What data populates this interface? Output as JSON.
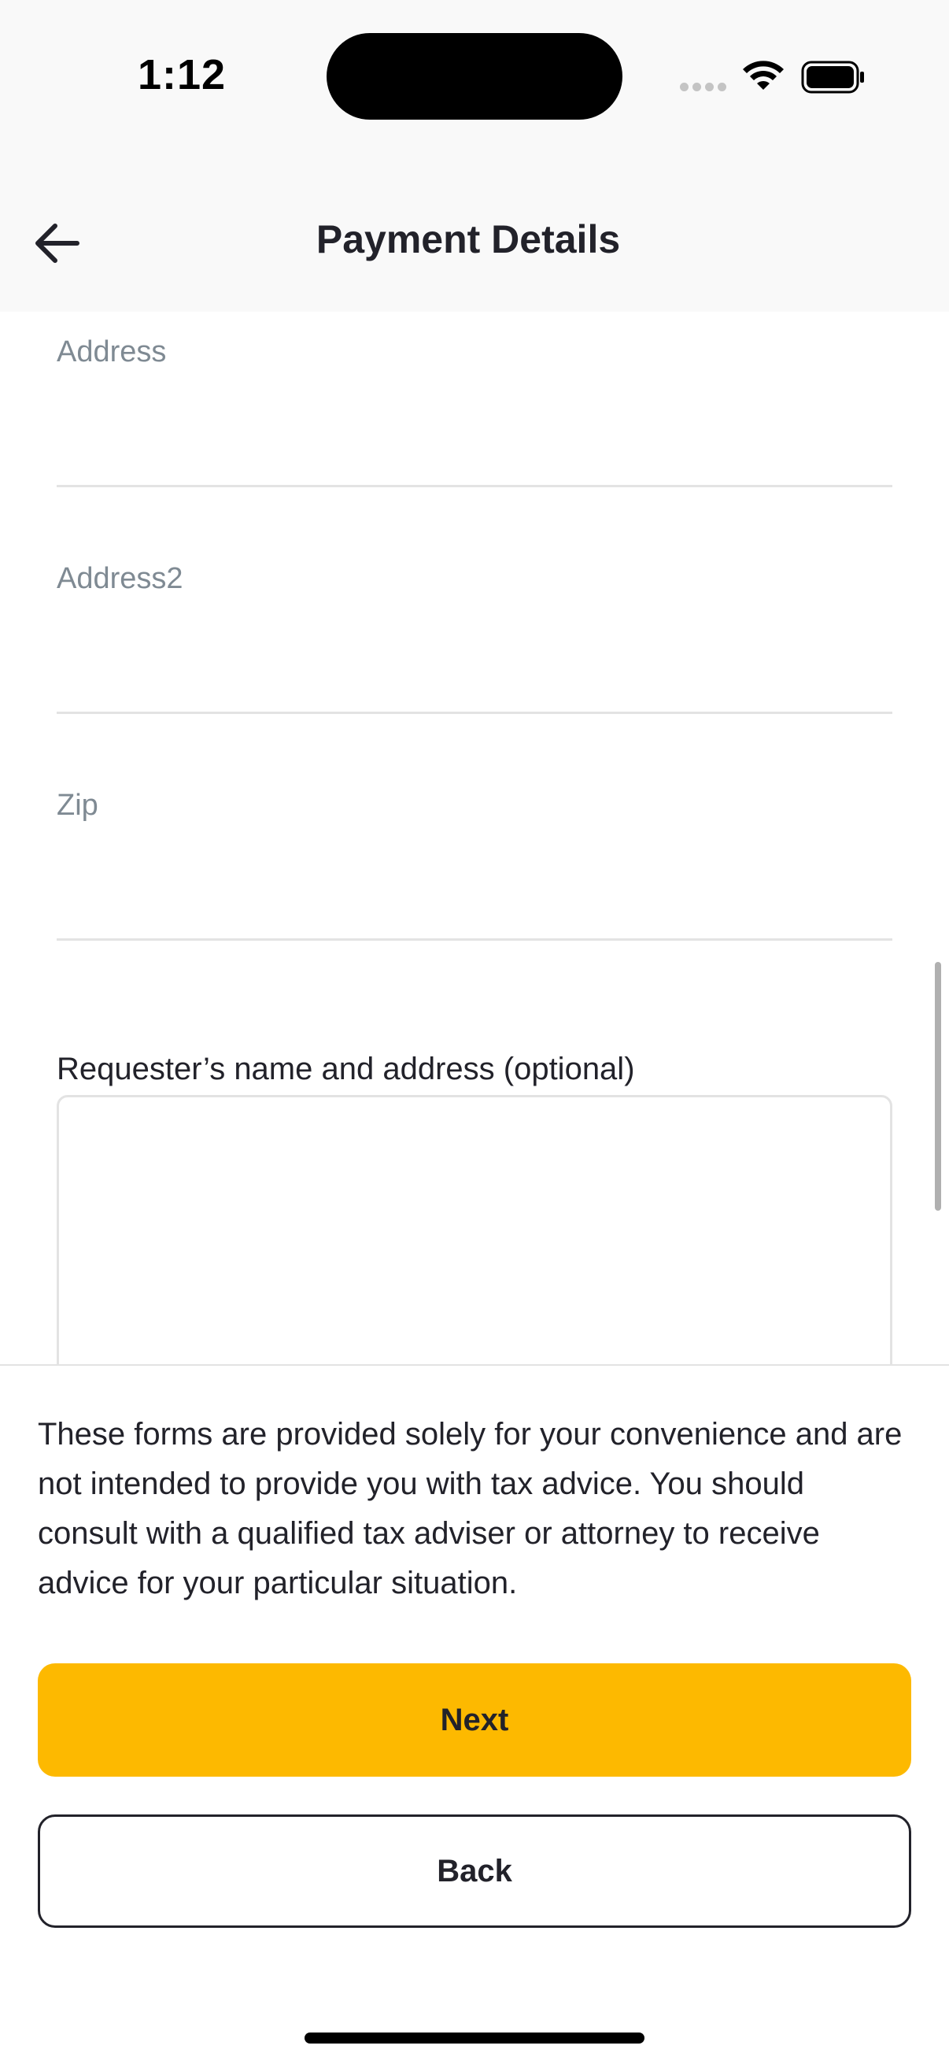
{
  "status_bar": {
    "time": "1:12"
  },
  "nav": {
    "title": "Payment Details"
  },
  "form": {
    "fields": [
      {
        "label": "Address",
        "value": ""
      },
      {
        "label": "Address2",
        "value": ""
      },
      {
        "label": "Zip",
        "value": ""
      }
    ],
    "requester_label": "Requester’s name and address (optional)",
    "requester_value": ""
  },
  "footer": {
    "disclaimer": "These forms are provided solely for your convenience and are not intended to provide you with tax advice. You should consult with a qualified tax adviser or attorney to receive advice for your particular situation.",
    "next_label": "Next",
    "back_label": "Back"
  },
  "colors": {
    "primary_button": "#fdb900",
    "text": "#22222a",
    "label_muted": "#7f8a93",
    "divider": "#e3e3e3"
  },
  "icons": {
    "back": "arrow-left-icon",
    "wifi": "wifi-icon",
    "battery": "battery-icon",
    "signal": "cellular-signal-icon"
  }
}
